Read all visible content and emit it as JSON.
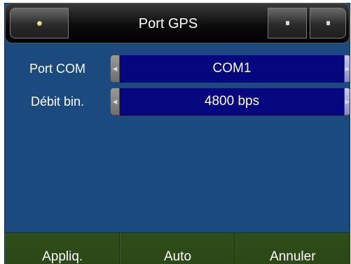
{
  "header": {
    "title": "Port GPS",
    "left_icon": "indicator-dot-icon",
    "right_icons": [
      "small-square-icon",
      "small-square-icon"
    ]
  },
  "rows": [
    {
      "label": "Port COM",
      "value": "COM1"
    },
    {
      "label": "Débit bin.",
      "value": "4800 bps"
    }
  ],
  "footer": {
    "apply_label": "Appliq.",
    "auto_label": "Auto",
    "cancel_label": "Annuler"
  },
  "colors": {
    "background": "#1a4a7e",
    "value_box": "#06067e",
    "footer": "#2e4c18",
    "header": "#0c0c0c"
  }
}
